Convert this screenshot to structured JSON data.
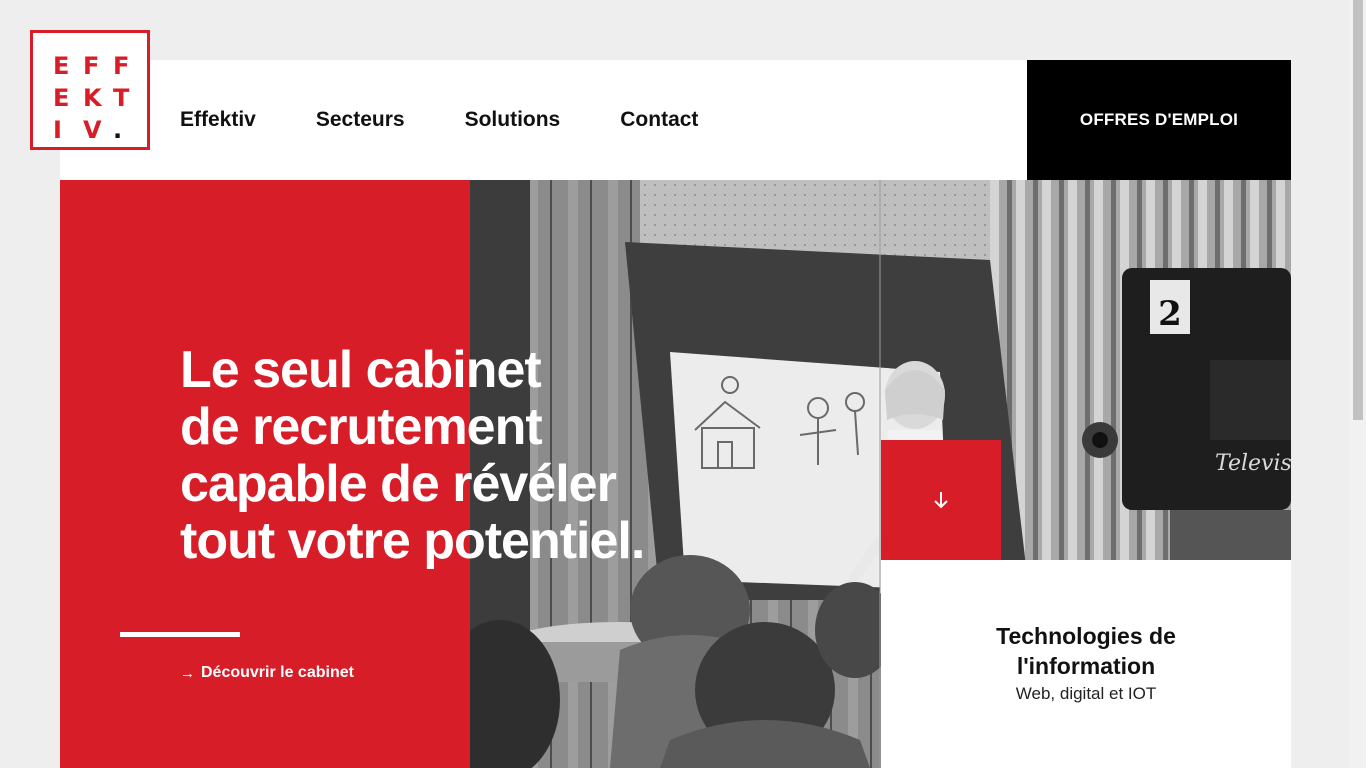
{
  "logo": {
    "letters": [
      "E",
      "F",
      "F",
      "E",
      "K",
      "T",
      "I",
      "V",
      "."
    ],
    "color": "#d71d28"
  },
  "nav": {
    "items": [
      {
        "label": "Effektiv"
      },
      {
        "label": "Secteurs"
      },
      {
        "label": "Solutions"
      },
      {
        "label": "Contact"
      }
    ],
    "jobs_button": "OFFRES D'EMPLOI"
  },
  "hero": {
    "headline_lines": [
      "Le seul cabinet",
      "de recrutement",
      "capable de révéler",
      "tout votre potentiel."
    ],
    "cta_arrow": "→",
    "cta_label": "Découvrir le cabinet",
    "scroll_icon": "arrow-down-icon",
    "photo_caption_number": "2",
    "photo_camera_brand": "Televis"
  },
  "sector": {
    "title_lines": [
      "Technologies de",
      "l'information"
    ],
    "subtitle": "Web, digital et IOT"
  },
  "colors": {
    "brand_red": "#d71d28",
    "black": "#000000",
    "white": "#ffffff",
    "page_bg": "#eeeeee"
  }
}
